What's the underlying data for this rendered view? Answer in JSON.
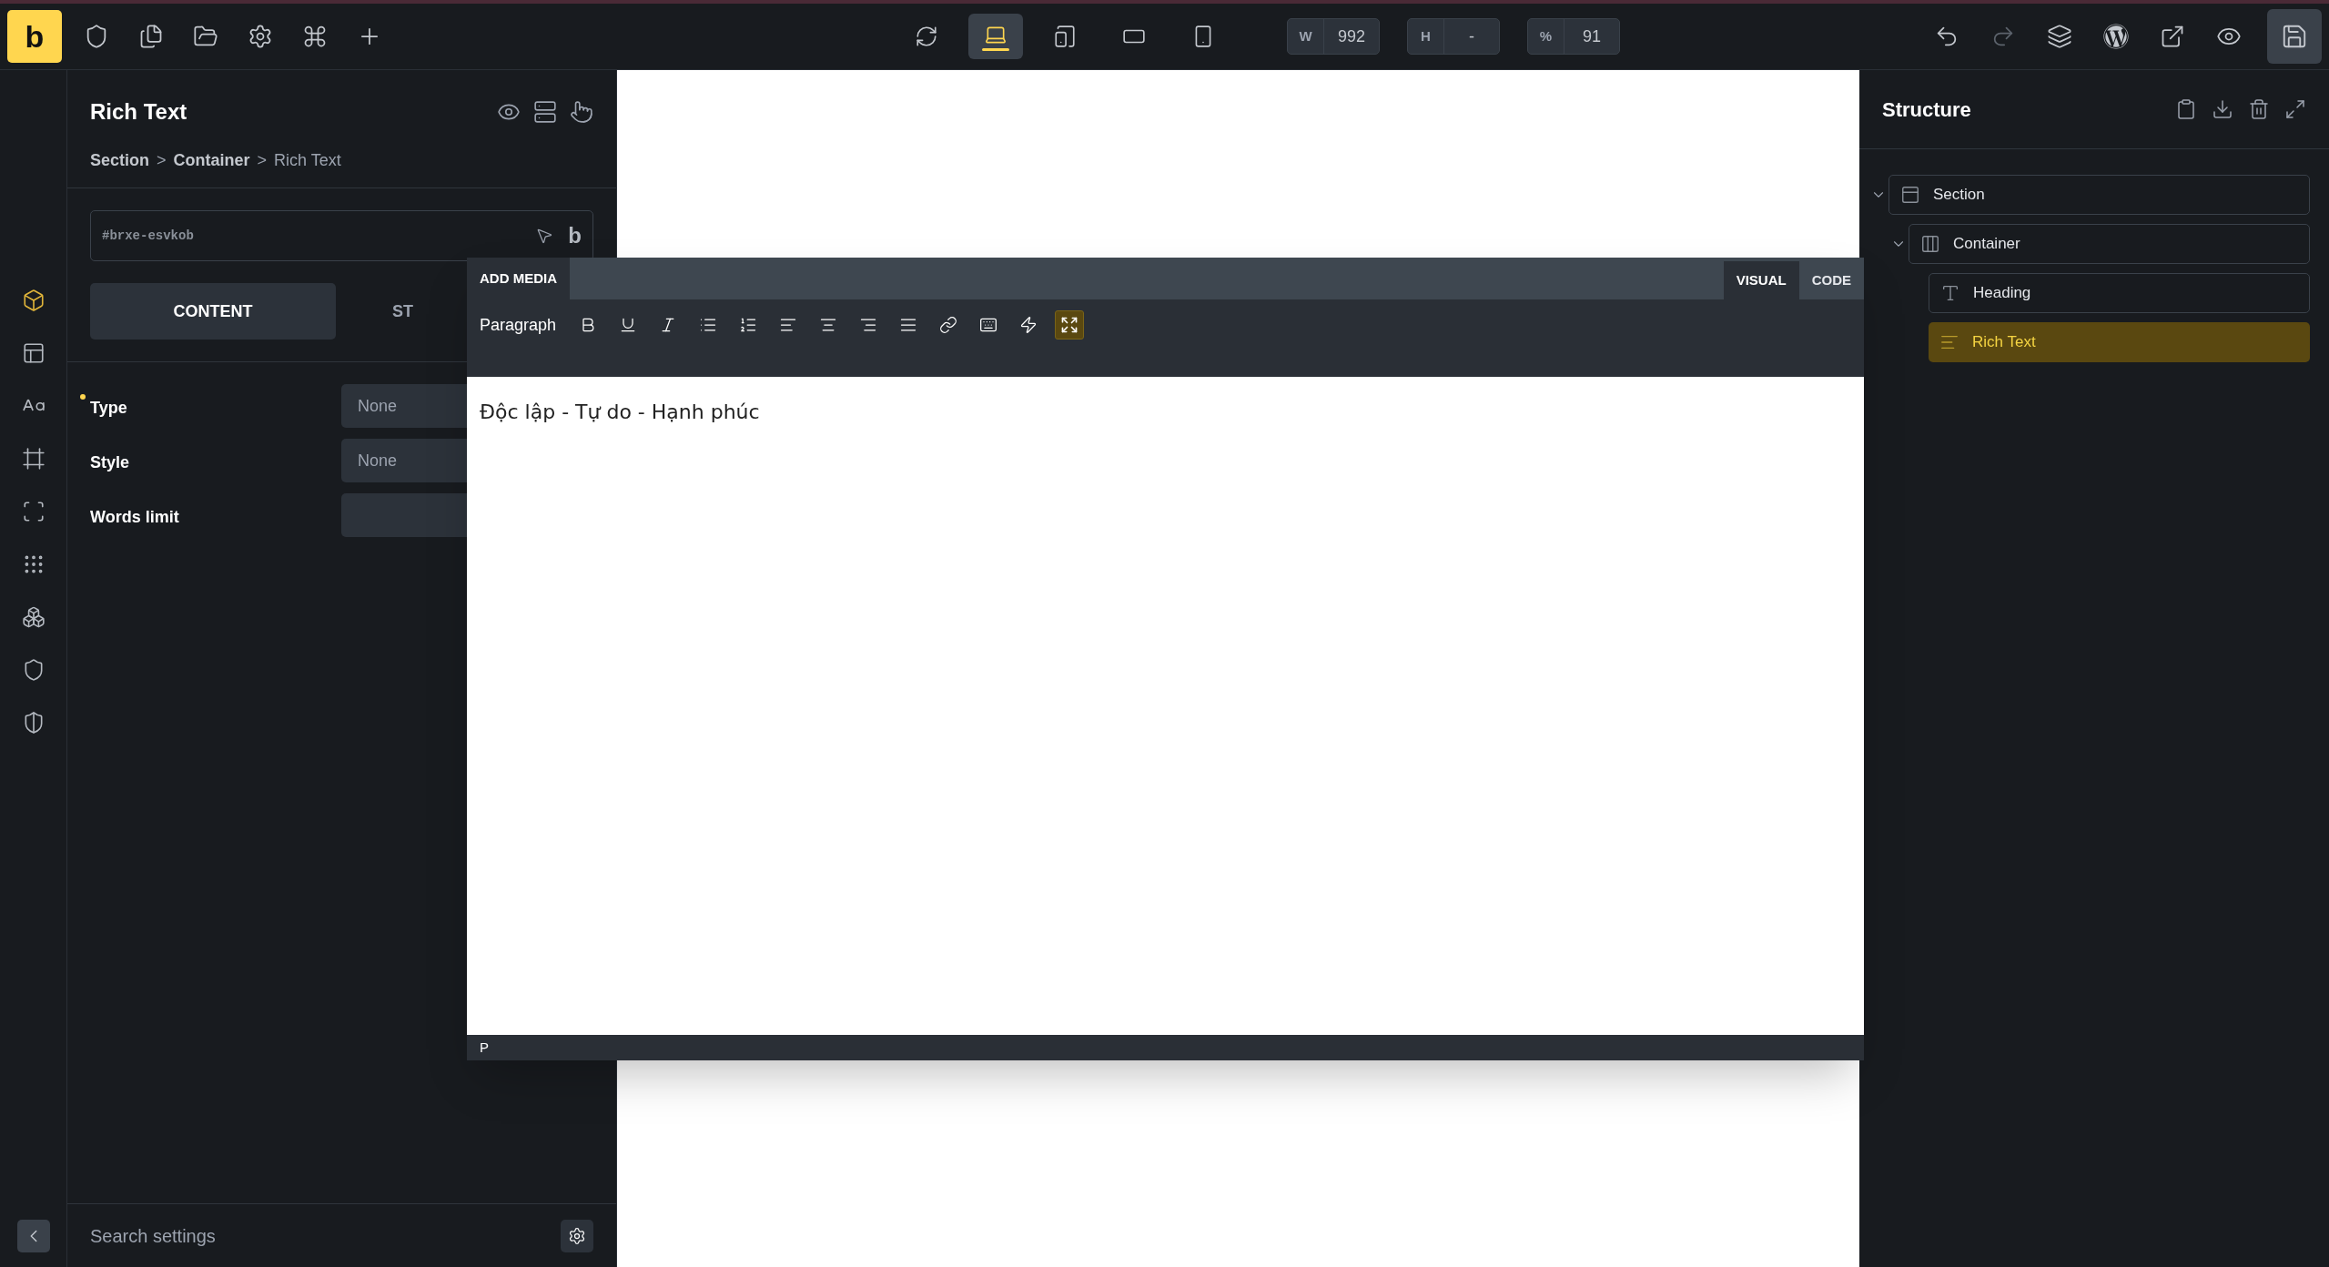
{
  "topbar": {
    "logo": "b",
    "device_modes": [
      {
        "selected": false
      },
      {
        "selected": true
      },
      {
        "selected": false
      },
      {
        "selected": false
      },
      {
        "selected": false
      }
    ],
    "size_fields": [
      {
        "label": "W",
        "value": "992"
      },
      {
        "label": "H",
        "value": "-"
      },
      {
        "label": "%",
        "value": "91"
      }
    ]
  },
  "rail_items": [
    {
      "selected": true
    },
    {
      "selected": false
    },
    {
      "selected": false
    },
    {
      "selected": false
    },
    {
      "selected": false
    },
    {
      "selected": false
    },
    {
      "selected": false
    },
    {
      "selected": false
    },
    {
      "selected": false
    }
  ],
  "panel": {
    "title": "Rich Text",
    "breadcrumb_separator": ">",
    "breadcrumb": [
      {
        "label": "Section",
        "current": false
      },
      {
        "label": "Container",
        "current": false
      },
      {
        "label": "Rich Text",
        "current": true
      }
    ],
    "element_id": "#brxe-esvkob",
    "brand_mark": "b",
    "tabs": [
      {
        "label": "CONTENT",
        "selected": true
      },
      {
        "label": "ST",
        "selected": false
      }
    ],
    "fields": [
      {
        "label": "Type",
        "value": "None",
        "modified": true
      },
      {
        "label": "Style",
        "value": "None",
        "modified": false
      },
      {
        "label": "Words limit",
        "modified": false
      }
    ],
    "search": {
      "placeholder": "Search settings"
    }
  },
  "editor": {
    "add_media": "ADD MEDIA",
    "modes": [
      {
        "label": "VISUAL",
        "selected": true
      },
      {
        "label": "CODE",
        "selected": false
      }
    ],
    "format": "Paragraph",
    "fullscreen_active": true,
    "content": "Độc lập - Tự do - Hạnh phúc",
    "path": "P"
  },
  "structure": {
    "title": "Structure",
    "tree": [
      {
        "label": "Section",
        "kind": "section",
        "expanded": true,
        "selected": false,
        "children": [
          {
            "label": "Container",
            "kind": "container",
            "expanded": true,
            "selected": false,
            "children": [
              {
                "label": "Heading",
                "kind": "heading",
                "selected": false
              },
              {
                "label": "Rich Text",
                "kind": "text",
                "selected": true
              }
            ]
          }
        ]
      }
    ]
  }
}
